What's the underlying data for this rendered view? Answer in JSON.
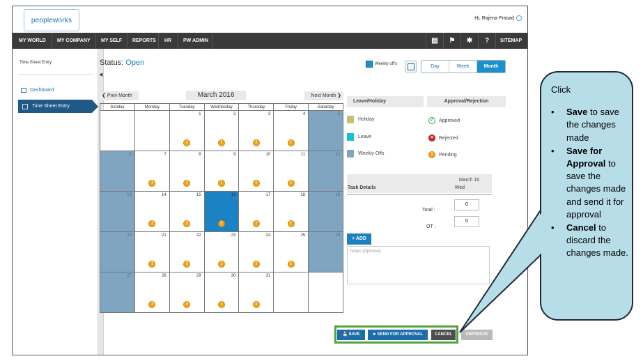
{
  "header": {
    "logo_text": "peopleworks",
    "greeting": "Hi, Rajena Prasad"
  },
  "nav": {
    "items": [
      "MY WORLD",
      "MY COMPANY",
      "MY SELF",
      "REPORTS",
      "HR",
      "PW ADMIN"
    ],
    "icons": [
      "book-icon",
      "flag-icon",
      "tools-icon",
      "help-icon"
    ],
    "sitemap": "SITEMAP"
  },
  "sidebar": {
    "title": "Time Sheet Entry",
    "items": [
      {
        "label": "Dashboard",
        "icon": "home-icon"
      },
      {
        "label": "Time Sheet Entry",
        "icon": "calendar-icon",
        "active": true
      }
    ]
  },
  "status": {
    "label": "Status:",
    "value": "Open"
  },
  "toolbar": {
    "weekly_offs_label": "Weekly off's",
    "views": [
      "Day",
      "Week",
      "Month"
    ],
    "active_view": "Month"
  },
  "calendar": {
    "prev_label": "Prev Month",
    "next_label": "Next Month",
    "month_title": "March 2016",
    "day_headers": [
      "Sunday",
      "Monday",
      "Tuesday",
      "Wednesday",
      "Thursday",
      "Friday",
      "Saturday"
    ],
    "weeks": [
      [
        "",
        "",
        "1",
        "2",
        "3",
        "4",
        "5"
      ],
      [
        "6",
        "7",
        "8",
        "9",
        "10",
        "11",
        "12"
      ],
      [
        "13",
        "14",
        "15",
        "16",
        "17",
        "18",
        "19"
      ],
      [
        "20",
        "21",
        "22",
        "23",
        "24",
        "25",
        "26"
      ],
      [
        "27",
        "28",
        "29",
        "30",
        "31",
        "",
        ""
      ]
    ],
    "weekly_off_columns": [
      0,
      6
    ],
    "selected_day": "16",
    "pending_icon": "!"
  },
  "legend": {
    "header": "Leave/Holiday",
    "items": [
      {
        "label": "Holiday",
        "color": "#c8c070"
      },
      {
        "label": "Leave",
        "color": "#14c2d1"
      },
      {
        "label": "Weekly Offs",
        "color": "#7fa5c0"
      }
    ]
  },
  "approval": {
    "header": "Approval/Rejection",
    "items": [
      {
        "label": "Approved",
        "icon": "check-circle-icon",
        "color": "#2aa84a"
      },
      {
        "label": "Rejected",
        "icon": "x-circle-icon",
        "color": "#d12c2c"
      },
      {
        "label": "Pending",
        "icon": "exclamation-circle-icon",
        "color": "#f0a41a"
      }
    ]
  },
  "task": {
    "header": "Task Details",
    "date_line1": "March 16",
    "date_line2": "Wed",
    "total_label": "Total :",
    "total_value": "0",
    "ot_label": "OT :",
    "ot_value": "0",
    "add_label": "+ ADD",
    "notes_placeholder": "Notes (Optional)"
  },
  "actions": {
    "save": "SAVE",
    "send_for_approval": "SEND FOR APPROVAL",
    "cancel": "CANCEL",
    "unfreeze": "UNFREEZE"
  },
  "callout": {
    "intro": "Click",
    "items": [
      {
        "bold": "Save",
        "rest": " to save the changes made"
      },
      {
        "bold": "Save for Approval",
        "rest": " to save the changes made and send it for approval"
      },
      {
        "bold": "Cancel",
        "rest": " to discard the changes made."
      }
    ]
  }
}
